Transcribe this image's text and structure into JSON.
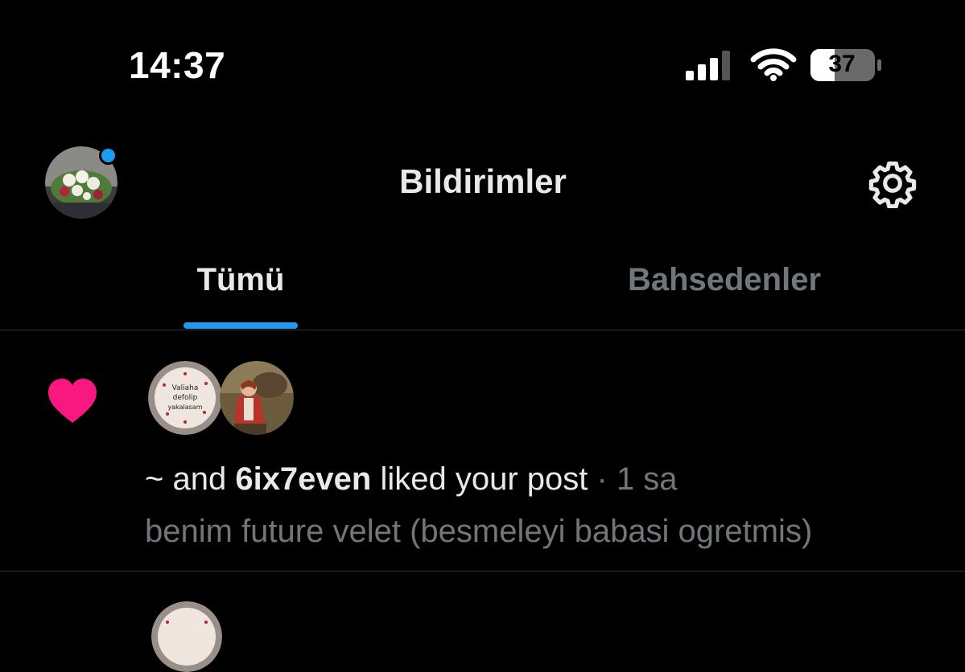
{
  "status_bar": {
    "time": "14:37",
    "battery_level": "37",
    "signal_icon": "cellular-signal-icon",
    "wifi_icon": "wifi-icon",
    "battery_icon": "battery-icon"
  },
  "header": {
    "title": "Bildirimler",
    "avatar_icon": "profile-avatar",
    "settings_icon": "gear-icon",
    "unread_dot_color": "#1d9bf0"
  },
  "tabs": [
    {
      "label": "Tümü",
      "active": true
    },
    {
      "label": "Bahsedenler",
      "active": false
    }
  ],
  "colors": {
    "accent": "#1d9bf0",
    "like": "#f91880",
    "text_primary": "#e7e9ea",
    "text_secondary": "#71767b",
    "divider": "#2f3336",
    "background": "#000000"
  },
  "notifications": [
    {
      "type_icon": "heart-icon",
      "actor_prefix": "~ and ",
      "actor_name": "6ix7even",
      "action": " liked your post",
      "separator": " · ",
      "time_ago": "1 sa",
      "post_text": "benim future velet (besmeleyi babasi ogretmis)",
      "avatar1_text": [
        "Valiaha",
        "defolip",
        "yakalasam"
      ]
    }
  ]
}
